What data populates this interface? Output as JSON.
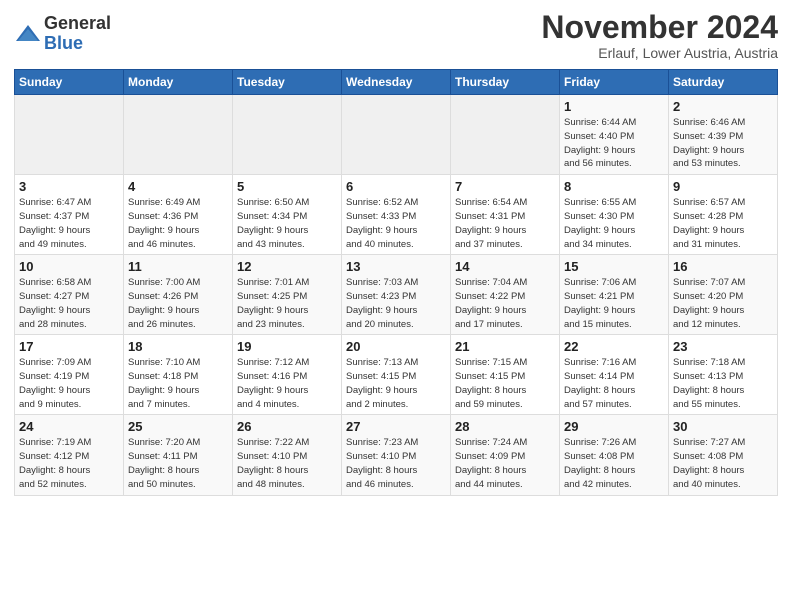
{
  "logo": {
    "text_general": "General",
    "text_blue": "Blue"
  },
  "header": {
    "month_year": "November 2024",
    "location": "Erlauf, Lower Austria, Austria"
  },
  "weekdays": [
    "Sunday",
    "Monday",
    "Tuesday",
    "Wednesday",
    "Thursday",
    "Friday",
    "Saturday"
  ],
  "weeks": [
    [
      {
        "day": "",
        "info": ""
      },
      {
        "day": "",
        "info": ""
      },
      {
        "day": "",
        "info": ""
      },
      {
        "day": "",
        "info": ""
      },
      {
        "day": "",
        "info": ""
      },
      {
        "day": "1",
        "info": "Sunrise: 6:44 AM\nSunset: 4:40 PM\nDaylight: 9 hours\nand 56 minutes."
      },
      {
        "day": "2",
        "info": "Sunrise: 6:46 AM\nSunset: 4:39 PM\nDaylight: 9 hours\nand 53 minutes."
      }
    ],
    [
      {
        "day": "3",
        "info": "Sunrise: 6:47 AM\nSunset: 4:37 PM\nDaylight: 9 hours\nand 49 minutes."
      },
      {
        "day": "4",
        "info": "Sunrise: 6:49 AM\nSunset: 4:36 PM\nDaylight: 9 hours\nand 46 minutes."
      },
      {
        "day": "5",
        "info": "Sunrise: 6:50 AM\nSunset: 4:34 PM\nDaylight: 9 hours\nand 43 minutes."
      },
      {
        "day": "6",
        "info": "Sunrise: 6:52 AM\nSunset: 4:33 PM\nDaylight: 9 hours\nand 40 minutes."
      },
      {
        "day": "7",
        "info": "Sunrise: 6:54 AM\nSunset: 4:31 PM\nDaylight: 9 hours\nand 37 minutes."
      },
      {
        "day": "8",
        "info": "Sunrise: 6:55 AM\nSunset: 4:30 PM\nDaylight: 9 hours\nand 34 minutes."
      },
      {
        "day": "9",
        "info": "Sunrise: 6:57 AM\nSunset: 4:28 PM\nDaylight: 9 hours\nand 31 minutes."
      }
    ],
    [
      {
        "day": "10",
        "info": "Sunrise: 6:58 AM\nSunset: 4:27 PM\nDaylight: 9 hours\nand 28 minutes."
      },
      {
        "day": "11",
        "info": "Sunrise: 7:00 AM\nSunset: 4:26 PM\nDaylight: 9 hours\nand 26 minutes."
      },
      {
        "day": "12",
        "info": "Sunrise: 7:01 AM\nSunset: 4:25 PM\nDaylight: 9 hours\nand 23 minutes."
      },
      {
        "day": "13",
        "info": "Sunrise: 7:03 AM\nSunset: 4:23 PM\nDaylight: 9 hours\nand 20 minutes."
      },
      {
        "day": "14",
        "info": "Sunrise: 7:04 AM\nSunset: 4:22 PM\nDaylight: 9 hours\nand 17 minutes."
      },
      {
        "day": "15",
        "info": "Sunrise: 7:06 AM\nSunset: 4:21 PM\nDaylight: 9 hours\nand 15 minutes."
      },
      {
        "day": "16",
        "info": "Sunrise: 7:07 AM\nSunset: 4:20 PM\nDaylight: 9 hours\nand 12 minutes."
      }
    ],
    [
      {
        "day": "17",
        "info": "Sunrise: 7:09 AM\nSunset: 4:19 PM\nDaylight: 9 hours\nand 9 minutes."
      },
      {
        "day": "18",
        "info": "Sunrise: 7:10 AM\nSunset: 4:18 PM\nDaylight: 9 hours\nand 7 minutes."
      },
      {
        "day": "19",
        "info": "Sunrise: 7:12 AM\nSunset: 4:16 PM\nDaylight: 9 hours\nand 4 minutes."
      },
      {
        "day": "20",
        "info": "Sunrise: 7:13 AM\nSunset: 4:15 PM\nDaylight: 9 hours\nand 2 minutes."
      },
      {
        "day": "21",
        "info": "Sunrise: 7:15 AM\nSunset: 4:15 PM\nDaylight: 8 hours\nand 59 minutes."
      },
      {
        "day": "22",
        "info": "Sunrise: 7:16 AM\nSunset: 4:14 PM\nDaylight: 8 hours\nand 57 minutes."
      },
      {
        "day": "23",
        "info": "Sunrise: 7:18 AM\nSunset: 4:13 PM\nDaylight: 8 hours\nand 55 minutes."
      }
    ],
    [
      {
        "day": "24",
        "info": "Sunrise: 7:19 AM\nSunset: 4:12 PM\nDaylight: 8 hours\nand 52 minutes."
      },
      {
        "day": "25",
        "info": "Sunrise: 7:20 AM\nSunset: 4:11 PM\nDaylight: 8 hours\nand 50 minutes."
      },
      {
        "day": "26",
        "info": "Sunrise: 7:22 AM\nSunset: 4:10 PM\nDaylight: 8 hours\nand 48 minutes."
      },
      {
        "day": "27",
        "info": "Sunrise: 7:23 AM\nSunset: 4:10 PM\nDaylight: 8 hours\nand 46 minutes."
      },
      {
        "day": "28",
        "info": "Sunrise: 7:24 AM\nSunset: 4:09 PM\nDaylight: 8 hours\nand 44 minutes."
      },
      {
        "day": "29",
        "info": "Sunrise: 7:26 AM\nSunset: 4:08 PM\nDaylight: 8 hours\nand 42 minutes."
      },
      {
        "day": "30",
        "info": "Sunrise: 7:27 AM\nSunset: 4:08 PM\nDaylight: 8 hours\nand 40 minutes."
      }
    ]
  ]
}
